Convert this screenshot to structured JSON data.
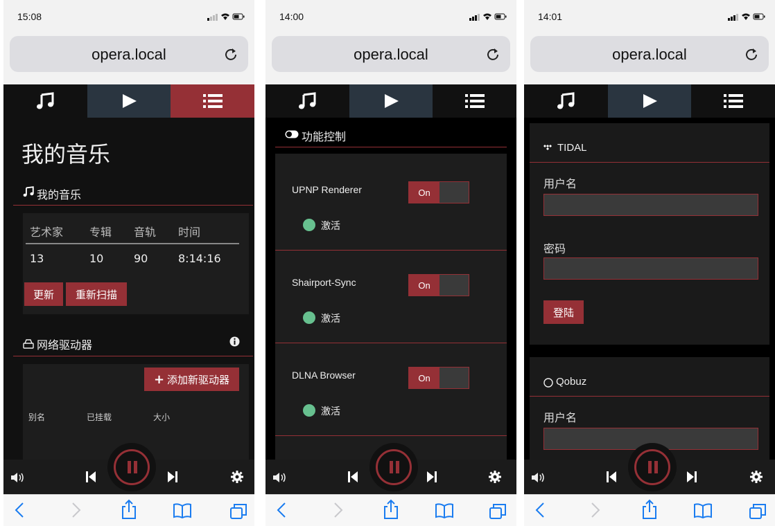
{
  "colors": {
    "accent": "#953036",
    "active_tab": "#2a3540",
    "status_green": "#67c08f"
  },
  "screens": [
    {
      "status_time": "15:08",
      "url": "opera.local",
      "page_title": "我的音乐",
      "library": {
        "header": "我的音乐",
        "columns": [
          "艺术家",
          "专辑",
          "音轨",
          "时间"
        ],
        "values": [
          "13",
          "10",
          "90",
          "8:14:16"
        ],
        "update_label": "更新",
        "rescan_label": "重新扫描"
      },
      "drives": {
        "header": "网络驱动器",
        "add_label": "添加新驱动器",
        "columns": [
          "别名",
          "已挂载",
          "大小"
        ]
      }
    },
    {
      "status_time": "14:00",
      "url": "opera.local",
      "section_header": "功能控制",
      "services": [
        {
          "name": "UPNP Renderer",
          "toggle": "On",
          "status": "激活"
        },
        {
          "name": "Shairport-Sync",
          "toggle": "On",
          "status": "激活"
        },
        {
          "name": "DLNA Browser",
          "toggle": "On",
          "status": "激活"
        }
      ]
    },
    {
      "status_time": "14:01",
      "url": "opera.local",
      "tidal": {
        "header": "TIDAL",
        "username_label": "用户名",
        "password_label": "密码",
        "login_label": "登陆"
      },
      "qobuz": {
        "header": "Qobuz",
        "username_label": "用户名"
      }
    }
  ]
}
